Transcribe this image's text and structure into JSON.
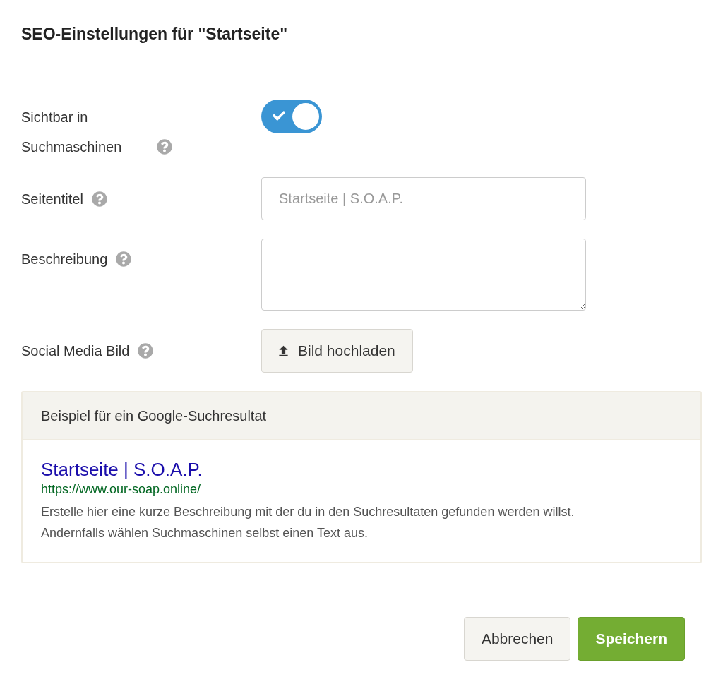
{
  "dialog": {
    "title": "SEO-Einstellungen für \"Startseite\""
  },
  "fields": [
    {
      "kind": "toggle",
      "label": "Sichtbar in Suchmaschinen",
      "help": true,
      "on": true
    },
    {
      "kind": "text",
      "label": "Seitentitel",
      "help": true,
      "placeholder": "Startseite | S.O.A.P."
    },
    {
      "kind": "textarea",
      "label": "Beschreibung",
      "help": true
    },
    {
      "kind": "upload",
      "label": "Social Media Bild",
      "help": true,
      "button": "Bild hochladen"
    }
  ],
  "preview": {
    "heading": "Beispiel für ein Google-Suchresultat",
    "result_title": "Startseite | S.O.A.P.",
    "result_url": "https://www.our-soap.online/",
    "result_description": "Erstelle hier eine kurze Beschreibung mit der du in den Suchresultaten gefunden werden willst. Andernfalls wählen Suchmaschinen selbst einen Text aus."
  },
  "buttons": [
    {
      "label": "Abbrechen",
      "kind": "secondary"
    },
    {
      "label": "Speichern",
      "kind": "primary"
    }
  ]
}
